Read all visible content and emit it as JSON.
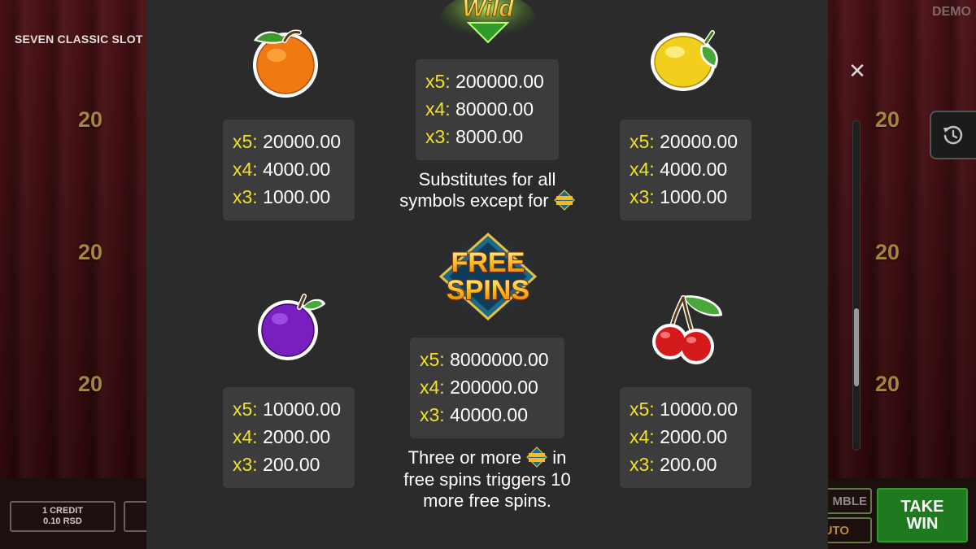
{
  "background": {
    "game_title": "SEVEN CLASSIC SLOT",
    "demo_label": "DEMO",
    "reel_numbers": [
      "20",
      "20",
      "20",
      "20",
      "20",
      "20"
    ],
    "credit_line1": "1 CREDIT",
    "credit_line2": "0.10 RSD",
    "gamble_label": "MBLE",
    "auto_label": "UTO",
    "take_win_line1": "TAKE",
    "take_win_line2": "WIN"
  },
  "paytable": {
    "orange": {
      "icon": "orange-icon",
      "rows": [
        {
          "mult": "x5:",
          "value": "20000.00"
        },
        {
          "mult": "x4:",
          "value": "4000.00"
        },
        {
          "mult": "x3:",
          "value": "1000.00"
        }
      ]
    },
    "wild": {
      "icon": "wild-icon",
      "logo_text": "Wild",
      "rows": [
        {
          "mult": "x5:",
          "value": "200000.00"
        },
        {
          "mult": "x4:",
          "value": "80000.00"
        },
        {
          "mult": "x3:",
          "value": "8000.00"
        }
      ],
      "desc_line1": "Substitutes for all",
      "desc_line2": "symbols except for"
    },
    "lemon": {
      "icon": "lemon-icon",
      "rows": [
        {
          "mult": "x5:",
          "value": "20000.00"
        },
        {
          "mult": "x4:",
          "value": "4000.00"
        },
        {
          "mult": "x3:",
          "value": "1000.00"
        }
      ]
    },
    "free_spins": {
      "icon": "free-spins-icon",
      "logo_line1": "FREE",
      "logo_line2": "SPINS",
      "rows": [
        {
          "mult": "x5:",
          "value": "8000000.00"
        },
        {
          "mult": "x4:",
          "value": "200000.00"
        },
        {
          "mult": "x3:",
          "value": "40000.00"
        }
      ],
      "desc_line1_a": "Three or more",
      "desc_line1_b": "in",
      "desc_line2": "free spins triggers 10",
      "desc_line3": "more free spins."
    },
    "plum": {
      "icon": "plum-icon",
      "rows": [
        {
          "mult": "x5:",
          "value": "10000.00"
        },
        {
          "mult": "x4:",
          "value": "2000.00"
        },
        {
          "mult": "x3:",
          "value": "200.00"
        }
      ]
    },
    "cherry": {
      "icon": "cherry-icon",
      "rows": [
        {
          "mult": "x5:",
          "value": "10000.00"
        },
        {
          "mult": "x4:",
          "value": "2000.00"
        },
        {
          "mult": "x3:",
          "value": "200.00"
        }
      ]
    }
  },
  "controls": {
    "close_icon": "close-icon",
    "history_icon": "history-icon"
  },
  "colors": {
    "multiplier": "#f0e12a",
    "panel": "#2b2b2b",
    "pay_box": "#3c3c3c",
    "take_win": "#1f7a1f"
  }
}
